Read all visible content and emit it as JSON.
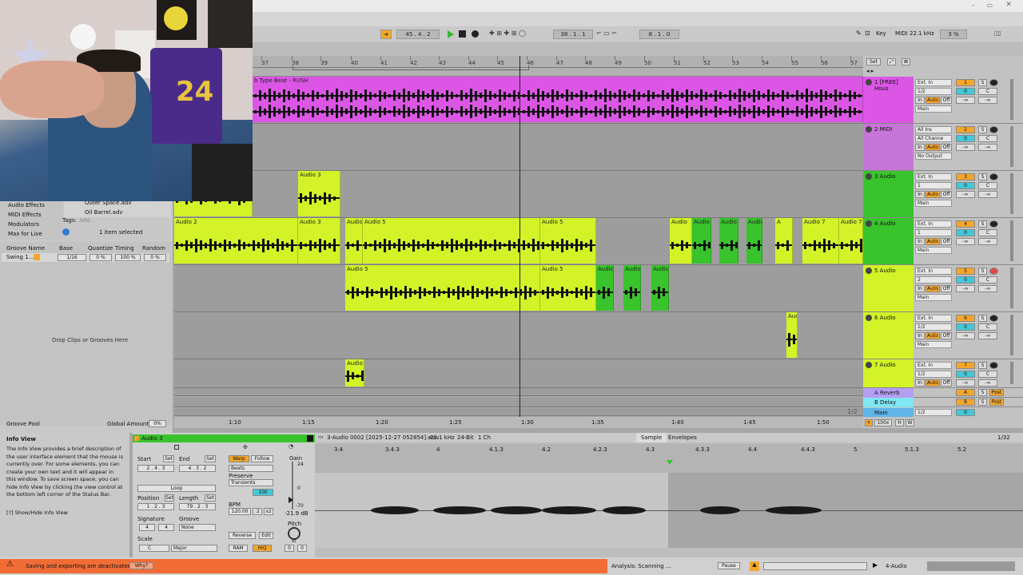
{
  "transport": {
    "position": "45 .  4 .  2",
    "loop_start": "38 .  1 .  1",
    "loop_length": "8 .  1 .  0",
    "key_label": "Key",
    "midi_label": "MIDI",
    "sample_rate": "22.1 kHz",
    "cpu": "3 %"
  },
  "ruler": {
    "bars": [
      "37",
      "38",
      "39",
      "40",
      "41",
      "42",
      "43",
      "44",
      "45",
      "46",
      "47",
      "48",
      "49",
      "50",
      "51",
      "52",
      "53",
      "54",
      "55",
      "56",
      "57"
    ],
    "set_label": "Set"
  },
  "tracks": [
    {
      "name": "1 [FREE] Hous",
      "color": "#dc56e6",
      "input": "Ext. In",
      "channel": "1/2",
      "output": "Main",
      "number": "1",
      "clip_label": "b Type Beat - RUSH"
    },
    {
      "name": "2 MIDI",
      "color": "#c676d6",
      "input": "All Ins",
      "channel": "All Channe",
      "output": "No Output",
      "number": "2"
    },
    {
      "name": "3 Audio",
      "color": "#39c32c",
      "input": "Ext. In",
      "channel": "1",
      "output": "Main",
      "number": "3",
      "clip_label": "Audio 3"
    },
    {
      "name": "4 Audio",
      "color": "#39c32c",
      "input": "Ext. In",
      "channel": "1",
      "output": "Main",
      "number": "4",
      "clip_labels": [
        "Audio 2",
        "Audio 3",
        "Audio 5",
        "Audio 5",
        "Audio 5",
        "Audio",
        "Audio",
        "Audio",
        "Audio",
        "A",
        "Audio 7",
        "Audio 7"
      ]
    },
    {
      "name": "5 Audio",
      "color": "#d3f227",
      "input": "Ext. In",
      "channel": "2",
      "output": "Main",
      "number": "5",
      "clip_labels": [
        "Audio 5",
        "Audio 5",
        "Audio",
        "Audio",
        "Audio"
      ]
    },
    {
      "name": "6 Audio",
      "color": "#d3f227",
      "input": "Ext. In",
      "channel": "1/2",
      "output": "Main",
      "number": "6",
      "clip_label": "Aud"
    },
    {
      "name": "7 Audio",
      "color": "#d3f227",
      "input": "Ext. In",
      "channel": "1/2",
      "output": "",
      "number": "7",
      "clip_label": "Audio"
    }
  ],
  "returns": [
    {
      "name": "A Reverb",
      "letter": "A",
      "send": "Post"
    },
    {
      "name": "B Delay",
      "letter": "B",
      "send": "Post"
    }
  ],
  "main": {
    "name": "Main",
    "channel": "1/2",
    "vol": "0"
  },
  "btn": {
    "in": "In",
    "auto": "Auto",
    "off": "Off",
    "s": "S",
    "c": "C",
    "inf": "-∞"
  },
  "browser": {
    "items": [
      "Audio Effects",
      "MIDI Effects",
      "Modulators",
      "Max for Live"
    ],
    "files": [
      "Outer Space.adv",
      "Oil Barrel.adv"
    ],
    "tags_label": "Tags:",
    "tags_add": "Add...",
    "selected": "1 item selected"
  },
  "groove": {
    "headers": [
      "Groove Name",
      "Base",
      "Quantize",
      "Timing",
      "Random"
    ],
    "row": {
      "name": "Swing 1...",
      "base": "1/16",
      "quantize": "0 %",
      "timing": "100 %",
      "random": "0 %"
    },
    "drop": "Drop Clips or Grooves Here",
    "pool": "Groove Pool",
    "global": "Global Amount",
    "global_val": "0%"
  },
  "timeline": {
    "labels": [
      "1:10",
      "1:15",
      "1:20",
      "1:25",
      "1:30",
      "1:35",
      "1:40",
      "1:45",
      "1:50"
    ],
    "zoom": "1/2",
    "view": "100x",
    "h": "H",
    "w": "W"
  },
  "info": {
    "title": "Info View",
    "text": "The Info View provides a brief description of the user interface element that the mouse is currently over. For some elements, you can create your own text and it will appear in this window. To save screen space, you can hide Info View by clicking the view control at the bottom left corner of the Status Bar.",
    "toggle": "[?] Show/Hide Info View"
  },
  "clip": {
    "name": "Audio 3",
    "start": "Start",
    "end": "End",
    "set": "Set",
    "start_val": "2 .  4 .  3",
    "end_val": "4 .  3 .  2",
    "loop": "Loop",
    "position": "Position",
    "length": "Length",
    "pos_val": "1 .  2 .  3",
    "len_val": "79 .  2 .  3",
    "signature": "Signature",
    "sig_num": "4",
    "sig_den": "4",
    "groove": "Groove",
    "groove_val": "None",
    "scale": "Scale",
    "root": "C",
    "mode": "Major",
    "warp": "Warp",
    "follow": "Follow",
    "warp_mode": "Beats",
    "preserve": "Preserve",
    "preserve_val": "Transients",
    "percent": "100",
    "bpm": "BPM",
    "bpm_val": "120.00",
    "half": ":2",
    "double": "x2",
    "gain": "Gain",
    "gain_max": "24",
    "gain_zero": "0",
    "gain_min": "-70",
    "gain_val": "-21.9 dB",
    "pitch": "Pitch",
    "semi": "st",
    "pitch_val": "0",
    "detune": "0",
    "reverse": "Reverse",
    "edit": "Edit",
    "ram": "RAM",
    "hiq": "HiQ"
  },
  "sample": {
    "file": "3-Audio 0002 [2025-12-27 052854].wav",
    "rate": "22.1 kHz",
    "bits": "24-Bit",
    "channels": "1 Ch",
    "tab1": "Sample",
    "tab2": "Envelopes",
    "grid": "1/32",
    "marks": [
      "3.4",
      "3.4.3",
      "4",
      "4.1.3",
      "4.2",
      "4.2.3",
      "4.3",
      "4.3.3",
      "4.4",
      "4.4.3",
      "5",
      "5.1.3",
      "5.2"
    ]
  },
  "status": {
    "warning": "Saving and exporting are deactivated.",
    "why": "Why?",
    "analysis": "Analysis: Scanning ...",
    "pause": "Pause",
    "track": "4-Audio"
  },
  "colors": {
    "magenta": "#dc56e6",
    "lime": "#d3f227",
    "green": "#39c32c",
    "orange": "#f26c36",
    "accent": "#f4a62a"
  }
}
